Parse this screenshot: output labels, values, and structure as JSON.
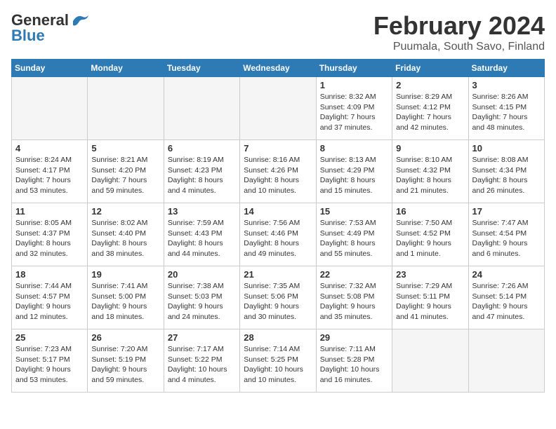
{
  "header": {
    "logo_general": "General",
    "logo_blue": "Blue",
    "main_title": "February 2024",
    "subtitle": "Puumala, South Savo, Finland"
  },
  "weekdays": [
    "Sunday",
    "Monday",
    "Tuesday",
    "Wednesday",
    "Thursday",
    "Friday",
    "Saturday"
  ],
  "weeks": [
    [
      {
        "day": "",
        "info": ""
      },
      {
        "day": "",
        "info": ""
      },
      {
        "day": "",
        "info": ""
      },
      {
        "day": "",
        "info": ""
      },
      {
        "day": "1",
        "info": "Sunrise: 8:32 AM\nSunset: 4:09 PM\nDaylight: 7 hours\nand 37 minutes."
      },
      {
        "day": "2",
        "info": "Sunrise: 8:29 AM\nSunset: 4:12 PM\nDaylight: 7 hours\nand 42 minutes."
      },
      {
        "day": "3",
        "info": "Sunrise: 8:26 AM\nSunset: 4:15 PM\nDaylight: 7 hours\nand 48 minutes."
      }
    ],
    [
      {
        "day": "4",
        "info": "Sunrise: 8:24 AM\nSunset: 4:17 PM\nDaylight: 7 hours\nand 53 minutes."
      },
      {
        "day": "5",
        "info": "Sunrise: 8:21 AM\nSunset: 4:20 PM\nDaylight: 7 hours\nand 59 minutes."
      },
      {
        "day": "6",
        "info": "Sunrise: 8:19 AM\nSunset: 4:23 PM\nDaylight: 8 hours\nand 4 minutes."
      },
      {
        "day": "7",
        "info": "Sunrise: 8:16 AM\nSunset: 4:26 PM\nDaylight: 8 hours\nand 10 minutes."
      },
      {
        "day": "8",
        "info": "Sunrise: 8:13 AM\nSunset: 4:29 PM\nDaylight: 8 hours\nand 15 minutes."
      },
      {
        "day": "9",
        "info": "Sunrise: 8:10 AM\nSunset: 4:32 PM\nDaylight: 8 hours\nand 21 minutes."
      },
      {
        "day": "10",
        "info": "Sunrise: 8:08 AM\nSunset: 4:34 PM\nDaylight: 8 hours\nand 26 minutes."
      }
    ],
    [
      {
        "day": "11",
        "info": "Sunrise: 8:05 AM\nSunset: 4:37 PM\nDaylight: 8 hours\nand 32 minutes."
      },
      {
        "day": "12",
        "info": "Sunrise: 8:02 AM\nSunset: 4:40 PM\nDaylight: 8 hours\nand 38 minutes."
      },
      {
        "day": "13",
        "info": "Sunrise: 7:59 AM\nSunset: 4:43 PM\nDaylight: 8 hours\nand 44 minutes."
      },
      {
        "day": "14",
        "info": "Sunrise: 7:56 AM\nSunset: 4:46 PM\nDaylight: 8 hours\nand 49 minutes."
      },
      {
        "day": "15",
        "info": "Sunrise: 7:53 AM\nSunset: 4:49 PM\nDaylight: 8 hours\nand 55 minutes."
      },
      {
        "day": "16",
        "info": "Sunrise: 7:50 AM\nSunset: 4:52 PM\nDaylight: 9 hours\nand 1 minute."
      },
      {
        "day": "17",
        "info": "Sunrise: 7:47 AM\nSunset: 4:54 PM\nDaylight: 9 hours\nand 6 minutes."
      }
    ],
    [
      {
        "day": "18",
        "info": "Sunrise: 7:44 AM\nSunset: 4:57 PM\nDaylight: 9 hours\nand 12 minutes."
      },
      {
        "day": "19",
        "info": "Sunrise: 7:41 AM\nSunset: 5:00 PM\nDaylight: 9 hours\nand 18 minutes."
      },
      {
        "day": "20",
        "info": "Sunrise: 7:38 AM\nSunset: 5:03 PM\nDaylight: 9 hours\nand 24 minutes."
      },
      {
        "day": "21",
        "info": "Sunrise: 7:35 AM\nSunset: 5:06 PM\nDaylight: 9 hours\nand 30 minutes."
      },
      {
        "day": "22",
        "info": "Sunrise: 7:32 AM\nSunset: 5:08 PM\nDaylight: 9 hours\nand 35 minutes."
      },
      {
        "day": "23",
        "info": "Sunrise: 7:29 AM\nSunset: 5:11 PM\nDaylight: 9 hours\nand 41 minutes."
      },
      {
        "day": "24",
        "info": "Sunrise: 7:26 AM\nSunset: 5:14 PM\nDaylight: 9 hours\nand 47 minutes."
      }
    ],
    [
      {
        "day": "25",
        "info": "Sunrise: 7:23 AM\nSunset: 5:17 PM\nDaylight: 9 hours\nand 53 minutes."
      },
      {
        "day": "26",
        "info": "Sunrise: 7:20 AM\nSunset: 5:19 PM\nDaylight: 9 hours\nand 59 minutes."
      },
      {
        "day": "27",
        "info": "Sunrise: 7:17 AM\nSunset: 5:22 PM\nDaylight: 10 hours\nand 4 minutes."
      },
      {
        "day": "28",
        "info": "Sunrise: 7:14 AM\nSunset: 5:25 PM\nDaylight: 10 hours\nand 10 minutes."
      },
      {
        "day": "29",
        "info": "Sunrise: 7:11 AM\nSunset: 5:28 PM\nDaylight: 10 hours\nand 16 minutes."
      },
      {
        "day": "",
        "info": ""
      },
      {
        "day": "",
        "info": ""
      }
    ]
  ]
}
